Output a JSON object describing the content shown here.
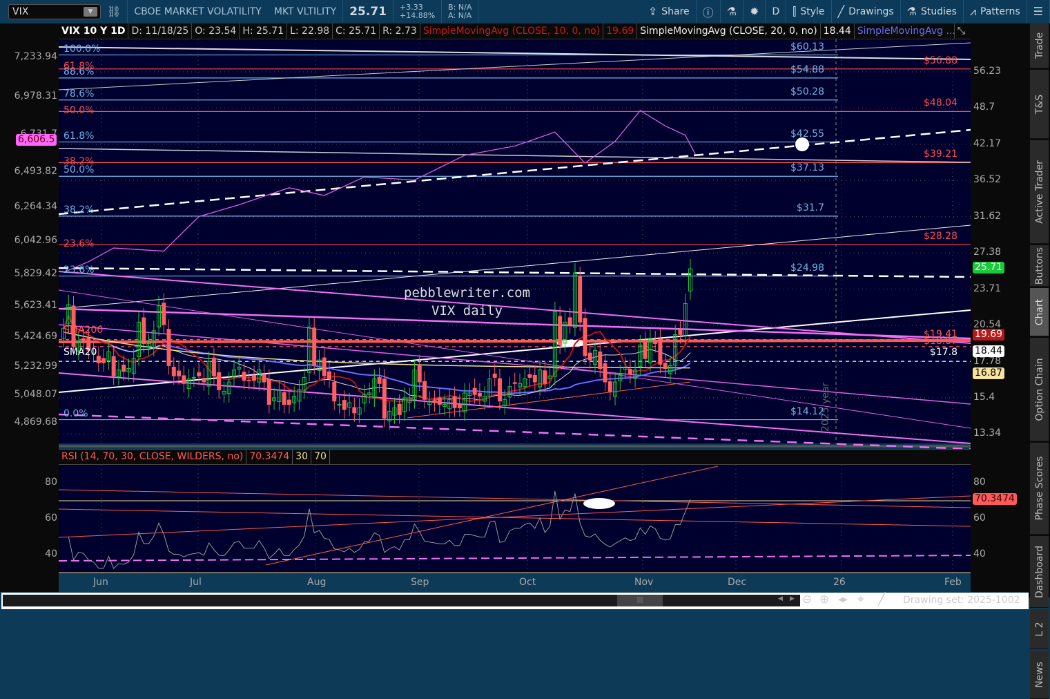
{
  "toolbar": {
    "symbol": "VIX",
    "description": "CBOE MARKET VOLATILITY",
    "short_name": "MKT VLTILITY",
    "last": "25.71",
    "change": "+3.33",
    "change_pct": "+14.88%",
    "bid": "B: N/A",
    "ask": "A: N/A",
    "buttons": [
      {
        "icon": "share-icon",
        "glyph": "⇪",
        "label": "Share"
      },
      {
        "icon": "info-icon",
        "glyph": "ⓘ",
        "label": ""
      },
      {
        "icon": "flask-icon",
        "glyph": "⚗",
        "label": ""
      },
      {
        "icon": "gear-icon",
        "glyph": "✹",
        "label": ""
      },
      {
        "icon": "aggregation",
        "glyph": "",
        "label": "D"
      },
      {
        "icon": "candle-style-icon",
        "glyph": "⫿",
        "label": "Style"
      },
      {
        "icon": "drawings-icon",
        "glyph": "╱",
        "label": "Drawings"
      },
      {
        "icon": "studies-icon",
        "glyph": "⚗",
        "label": "Studies"
      },
      {
        "icon": "patterns-icon",
        "glyph": "⩘",
        "label": "Patterns"
      },
      {
        "icon": "menu-icon",
        "glyph": "☰",
        "label": ""
      }
    ]
  },
  "header": {
    "title": "VIX 10 Y 1D",
    "date": "D: 11/18/25",
    "open": "O: 23.54",
    "high": "H: 25.71",
    "low": "L: 22.98",
    "close": "C: 25.71",
    "range": "R: 2.73",
    "sma10": "SimpleMovingAvg (CLOSE, 10, 0, no)",
    "sma10_val": "19.69",
    "sma20": "SimpleMovingAvg (CLOSE, 20, 0, no)",
    "sma20_val": "18.44",
    "sma50": "SimpleMovingAvg ..."
  },
  "watermark": {
    "line1": "pebblewriter.com",
    "line2": "VIX daily"
  },
  "study_labels": {
    "sma200": "SMA200",
    "sma20": "SMA20"
  },
  "year_label": "2025 year",
  "right_axis": [
    "56.23",
    "48.7",
    "42.17",
    "36.52",
    "31.62",
    "27.38",
    "23.71",
    "20.54",
    "17.78",
    "15.4",
    "13.34"
  ],
  "left_axis": [
    "7,233.94",
    "6,978.31",
    "6,731.7",
    "6,493.82",
    "6,264.34",
    "6,042.96",
    "5,829.42",
    "5,623.41",
    "5,424.69",
    "5,232.99",
    "5,048.07",
    "4,869.68"
  ],
  "badges": {
    "last": "25.71",
    "sma10": "19.69",
    "sma20": "18.44",
    "sma50": "16.87",
    "spx": "6,606.5",
    "rsi": "70.3474"
  },
  "fib_blue": [
    {
      "pct": "100.0%",
      "price": 60.13,
      "label": "$60.13"
    },
    {
      "pct": "88.6%",
      "price": 54.88,
      "label": "$54.88"
    },
    {
      "pct": "78.6%",
      "price": 50.28,
      "label": "$50.28"
    },
    {
      "pct": "61.8%",
      "price": 42.55,
      "label": "$42.55"
    },
    {
      "pct": "50.0%",
      "price": 37.13,
      "label": "$37.13"
    },
    {
      "pct": "38.2%",
      "price": 31.7,
      "label": "$31.7"
    },
    {
      "pct": "23.6%",
      "price": 24.98,
      "label": "$24.98"
    },
    {
      "pct": "0.0%",
      "price": 14.12,
      "label": "$14.12"
    }
  ],
  "fib_red": [
    {
      "pct": "61.8%",
      "price": 56.88,
      "label": "$56.88"
    },
    {
      "pct": "50.0%",
      "price": 48.04,
      "label": "$48.04"
    },
    {
      "pct": "38.2%",
      "price": 39.21,
      "label": "$39.21"
    },
    {
      "pct": "23.6%",
      "price": 28.28,
      "label": "$28.28"
    }
  ],
  "levels": [
    {
      "price": 19.41,
      "label": "$19.41",
      "color": "#ff5a4e"
    },
    {
      "price": 18.87,
      "label": "$18.87",
      "color": "#ff5a4e"
    },
    {
      "price": 17.8,
      "label": "$17.8",
      "color": "#ffffff"
    }
  ],
  "rsi": {
    "title": "RSI (14, 70, 30, CLOSE, WILDERS, no)",
    "value": "70.3474",
    "ob": "30",
    "os": "70",
    "axis": [
      "80",
      "60",
      "40"
    ]
  },
  "date_axis": [
    "Jun",
    "Jul",
    "Aug",
    "Sep",
    "Oct",
    "Nov",
    "Dec",
    "26",
    "Feb"
  ],
  "bottom": {
    "drawing_set": "Drawing set: 2025-1002"
  },
  "sidebar": [
    "Trade",
    "T&S",
    "Active Trader",
    "Buttons",
    "Chart",
    "Option Chain",
    "Phase Scores",
    "Dashboard",
    "L 2",
    "News"
  ],
  "colors": {
    "bg": "#00002e",
    "up": "#19c93a",
    "down": "#ff5f5f",
    "fib_blue": "#6fb4e6",
    "fib_red": "#ff4b4b",
    "spx": "#e05be0"
  },
  "chart_data": {
    "type": "candlestick",
    "symbol": "VIX",
    "first_date": "2025-05-22",
    "last_date": "2025-11-18",
    "closes": [
      20.3,
      22.3,
      18.9,
      19.3,
      19.2,
      18.6,
      18.4,
      17.7,
      17.7,
      18.5,
      16.8,
      17.2,
      17.1,
      17.3,
      18.0,
      20.8,
      19.1,
      19.1,
      20.1,
      22.2,
      20.6,
      17.5,
      16.8,
      16.8,
      16.3,
      16.6,
      16.7,
      16.8,
      16.4,
      17.8,
      16.8,
      15.9,
      15.8,
      16.4,
      17.2,
      17.4,
      16.5,
      16.5,
      16.5,
      17.2,
      16.4,
      15.0,
      15.4,
      15.9,
      15.0,
      15.0,
      15.5,
      15.9,
      16.7,
      20.4,
      17.5,
      17.9,
      16.8,
      16.6,
      15.2,
      15.0,
      14.7,
      15.1,
      14.5,
      14.8,
      15.6,
      15.7,
      16.6,
      16.3,
      14.2,
      14.6,
      14.8,
      14.4,
      15.4,
      15.4,
      17.2,
      16.4,
      15.3,
      15.2,
      15.1,
      15.0,
      15.0,
      15.3,
      14.8,
      14.8,
      15.7,
      15.7,
      15.6,
      15.5,
      15.5,
      16.6,
      16.7,
      15.2,
      15.3,
      16.1,
      16.3,
      16.3,
      16.6,
      16.7,
      16.4,
      17.2,
      16.3,
      16.8,
      21.7,
      19.0,
      20.8,
      20.6,
      25.3,
      20.8,
      18.2,
      17.9,
      18.6,
      17.3,
      16.4,
      15.8,
      16.4,
      16.9,
      17.4,
      16.9,
      17.2,
      19.0,
      18.0,
      19.5,
      19.1,
      17.6,
      17.3,
      17.5,
      19.8,
      19.8,
      22.4,
      25.71
    ],
    "spx_comparison": [
      [
        0,
        5842
      ],
      [
        5,
        5912
      ],
      [
        10,
        6000
      ],
      [
        20,
        5980
      ],
      [
        27,
        6204
      ],
      [
        35,
        6280
      ],
      [
        45,
        6390
      ],
      [
        52,
        6340
      ],
      [
        60,
        6460
      ],
      [
        70,
        6440
      ],
      [
        80,
        6600
      ],
      [
        90,
        6660
      ],
      [
        98,
        6750
      ],
      [
        104,
        6550
      ],
      [
        110,
        6690
      ],
      [
        115,
        6890
      ],
      [
        120,
        6790
      ],
      [
        124,
        6730
      ],
      [
        126,
        6606.5
      ]
    ],
    "price_range": [
      13.34,
      56.23
    ],
    "rsi_range": [
      30,
      80
    ]
  }
}
